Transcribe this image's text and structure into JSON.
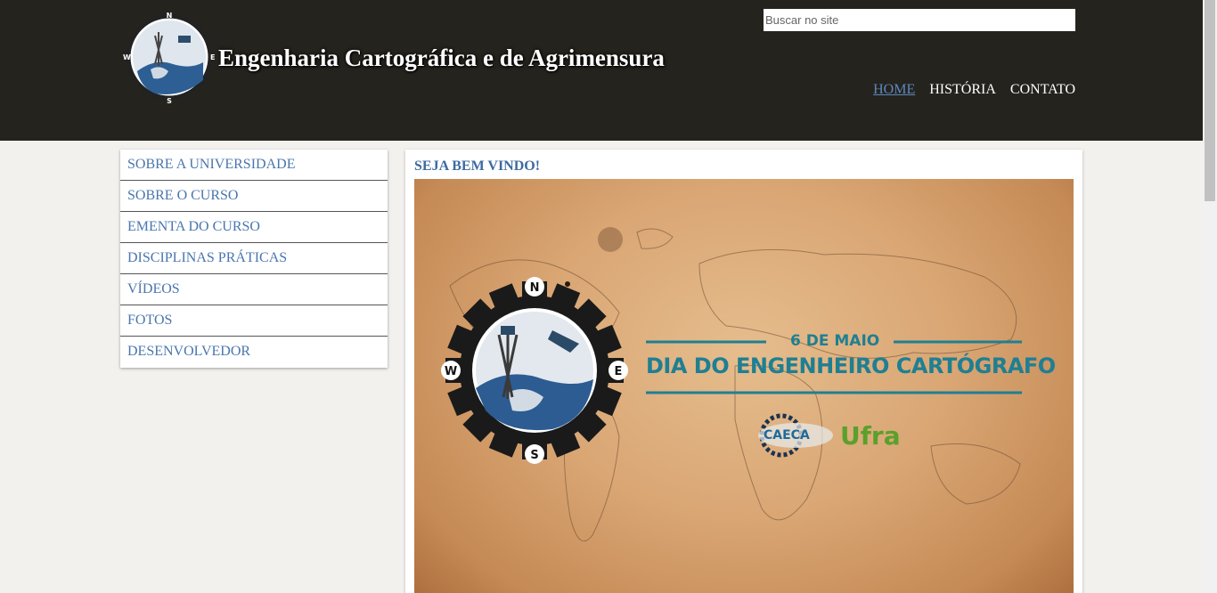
{
  "header": {
    "site_title": "Engenharia Cartográfica e de Agrimensura",
    "search_placeholder": "Buscar no site",
    "nav": [
      {
        "label": "HOME",
        "active": true
      },
      {
        "label": "HISTÓRIA",
        "active": false
      },
      {
        "label": "CONTATO",
        "active": false
      }
    ],
    "logo_icon": "compass-globe-logo"
  },
  "sidebar": {
    "items": [
      {
        "label": "SOBRE A UNIVERSIDADE"
      },
      {
        "label": "SOBRE O CURSO"
      },
      {
        "label": "EMENTA DO CURSO"
      },
      {
        "label": "DISCIPLINAS PRÁTICAS"
      },
      {
        "label": "VÍDEOS"
      },
      {
        "label": "FOTOS"
      },
      {
        "label": "DESENVOLVEDOR"
      }
    ]
  },
  "main": {
    "heading": "SEJA BEM VINDO!",
    "banner": {
      "date": "6 DE MAIO",
      "title": "DIA DO ENGENHEIRO CARTÓGRAFO",
      "logo_left": "CAECA",
      "logo_right": "Ufra",
      "compass": {
        "n": "N",
        "s": "S",
        "e": "E",
        "w": "W"
      }
    }
  },
  "colors": {
    "header_bg": "#25231d",
    "page_bg": "#f2f1ee",
    "link": "#4a76ad",
    "nav_active": "#5b88c0",
    "banner_accent": "#1f7f93"
  }
}
